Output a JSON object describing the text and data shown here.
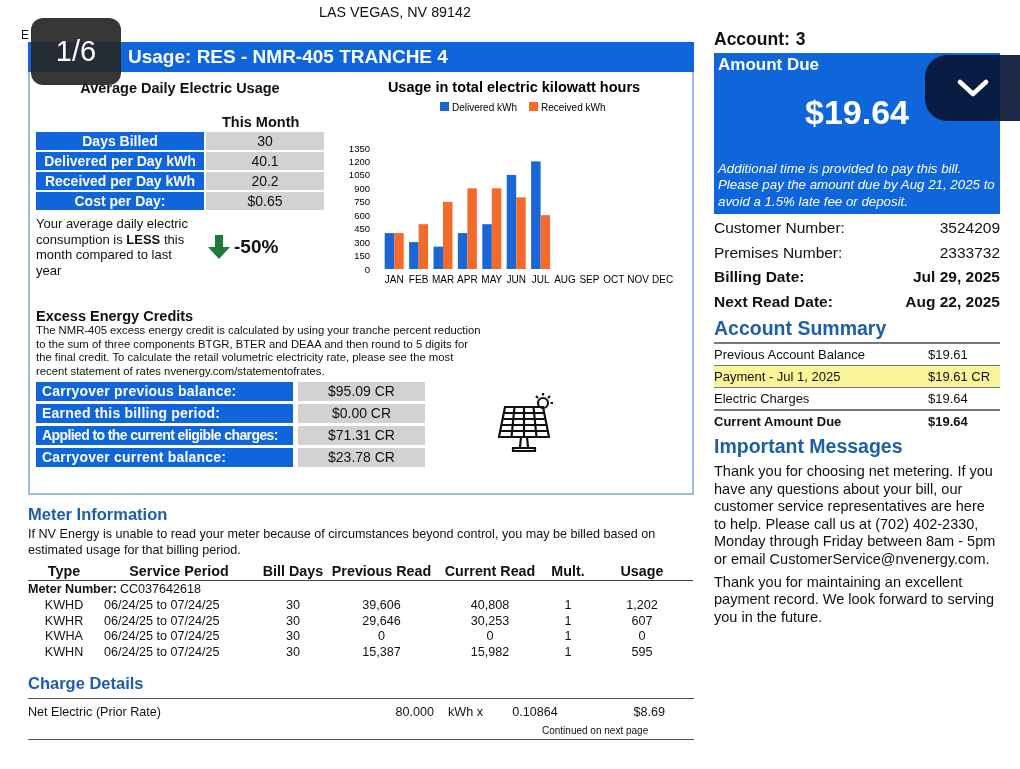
{
  "viewer": {
    "page_counter": "1/6"
  },
  "header": {
    "address_line": "LAS VEGAS, NV 89142",
    "code": "E"
  },
  "usage": {
    "title": "Usage: RES - NMR-405 TRANCHE 4",
    "average_title": "Average Daily Electric Usage",
    "column_heading": "This Month",
    "stats": [
      {
        "label": "Days Billed",
        "value": "30"
      },
      {
        "label": "Delivered per Day kWh",
        "value": "40.1"
      },
      {
        "label": "Received per Day kWh",
        "value": "20.2"
      },
      {
        "label": "Cost per Day:",
        "value": "$0.65"
      }
    ],
    "comparison": {
      "text": "Your average daily electric consumption is **LESS** this month compared to last year",
      "change": "-50%"
    },
    "chart_data": {
      "type": "bar",
      "title": "Usage in total electric kilowatt hours",
      "categories": [
        "JAN",
        "FEB",
        "MAR",
        "APR",
        "MAY",
        "JUN",
        "JUL",
        "AUG",
        "SEP",
        "OCT",
        "NOV",
        "DEC"
      ],
      "series": [
        {
          "name": "Delivered kWh",
          "color": "#1a66d6",
          "values": [
            400,
            300,
            250,
            400,
            500,
            1050,
            1200,
            null,
            null,
            null,
            null,
            null
          ]
        },
        {
          "name": "Received kWh",
          "color": "#f26b2a",
          "values": [
            400,
            500,
            750,
            900,
            900,
            800,
            600,
            null,
            null,
            null,
            null,
            null
          ]
        }
      ],
      "legend": true,
      "ylim": [
        0,
        1350
      ],
      "yticks": [
        0,
        150,
        300,
        450,
        600,
        750,
        900,
        1050,
        1200,
        1350
      ]
    },
    "credits": {
      "title": "Excess Energy Credits",
      "description": "The NMR-405 excess energy credit is calculated by using your tranche percent reduction to the sum of three components BTGR, BTER and DEAA and then round to 5 digits for the final credit. To calculate the retail volumetric electricity rate, please see the most recent statement of rates nvenergy.com/statementofrates.",
      "rows": [
        {
          "label": "Carryover previous balance:",
          "value": "$95.09 CR"
        },
        {
          "label": "Earned this billing period:",
          "value": "$0.00 CR"
        },
        {
          "label": "Applied to the current eligible charges:",
          "value": "$71.31 CR"
        },
        {
          "label": "Carryover current balance:",
          "value": "$23.78 CR"
        }
      ]
    }
  },
  "meter": {
    "title": "Meter Information",
    "note": "If NV Energy is unable to read your meter because of circumstances beyond control, you may be billed based on estimated usage for that billing period.",
    "columns": [
      "Type",
      "Service Period",
      "Bill Days",
      "Previous Read",
      "Current Read",
      "Mult.",
      "Usage"
    ],
    "meter_label": "Meter Number:",
    "meter_number": "CC037642618",
    "rows": [
      [
        "KWHD",
        "06/24/25 to 07/24/25",
        "30",
        "39,606",
        "40,808",
        "1",
        "1,202"
      ],
      [
        "KWHR",
        "06/24/25 to 07/24/25",
        "30",
        "29,646",
        "30,253",
        "1",
        "607"
      ],
      [
        "KWHA",
        "06/24/25 to 07/24/25",
        "30",
        "0",
        "0",
        "1",
        "0"
      ],
      [
        "KWHN",
        "06/24/25 to 07/24/25",
        "30",
        "15,387",
        "15,982",
        "1",
        "595"
      ]
    ]
  },
  "charges": {
    "title": "Charge Details",
    "rows": [
      {
        "description": "Net Electric (Prior Rate)",
        "quantity": "80.000",
        "unit": "kWh x",
        "rate": "0.10864",
        "amount": "$8.69"
      }
    ],
    "footer": "Continued on next page"
  },
  "account": {
    "label": "Account:",
    "number": "3",
    "amount_due_label": "Amount Due",
    "amount": "$19.64",
    "note": "Additional time is provided to pay this bill. Please pay the amount due by Aug 21, 2025 to avoid a 1.5% late fee or deposit.",
    "details": [
      {
        "label": "Customer Number:",
        "value": "3524209",
        "bold": false
      },
      {
        "label": "Premises Number:",
        "value": "2333732",
        "bold": false
      },
      {
        "label": "Billing Date:",
        "value": "Jul 29, 2025",
        "bold": true
      },
      {
        "label": "Next Read Date:",
        "value": "Aug 22, 2025",
        "bold": true
      }
    ],
    "summary": {
      "title": "Account Summary",
      "rows": [
        {
          "label": "Previous Account Balance",
          "value": "$19.61",
          "highlighted": false,
          "bold": false
        },
        {
          "label": "Payment - Jul 1, 2025",
          "value": "$19.61 CR",
          "highlighted": true,
          "bold": false
        },
        {
          "label": "Electric Charges",
          "value": "$19.64",
          "highlighted": false,
          "bold": false
        },
        {
          "label": "Current Amount Due",
          "value": "$19.64",
          "highlighted": false,
          "bold": true
        }
      ]
    },
    "messages": {
      "title": "Important Messages",
      "paragraphs": [
        "Thank you for choosing net metering. If you have any questions about your bill, our customer service representatives are here to help. Please call us at (702) 402-2330, Monday through Friday between 8am - 5pm or email CustomerService@nvenergy.com.",
        "Thank you for maintaining an excellent payment record. We look forward to serving you in the future."
      ]
    }
  }
}
